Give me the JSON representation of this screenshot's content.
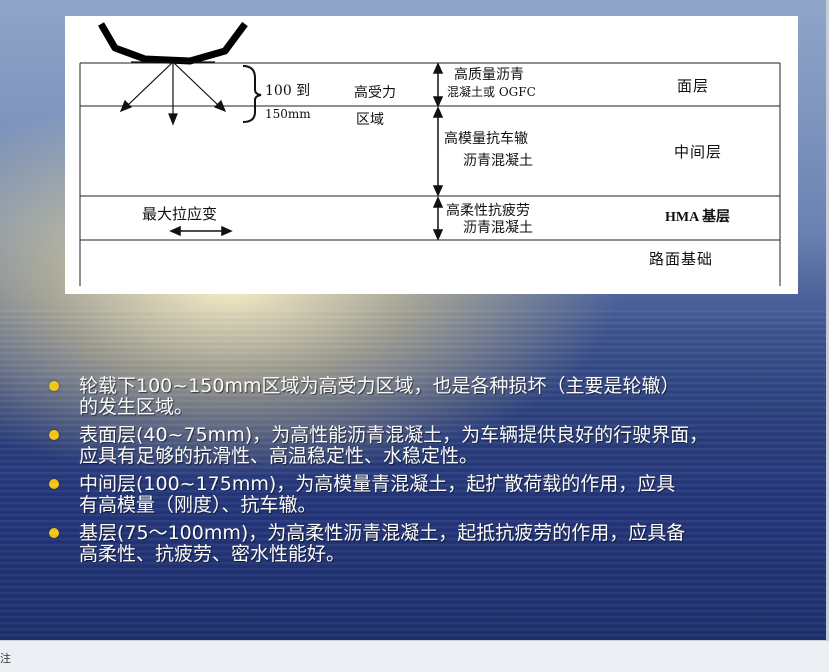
{
  "diagram": {
    "brace_line1": "100 到",
    "brace_line2": "150mm",
    "zone_line1": "高受力",
    "zone_line2": "区域",
    "surface_mat_line1": "高质量沥青",
    "surface_mat_line2": "混凝土或 OGFC",
    "surface_layer": "面层",
    "middle_mat_line1": "高模量抗车辙",
    "middle_mat_line2": "沥青混凝土",
    "middle_layer": "中间层",
    "strain_label": "最大拉应变",
    "base_mat_line1": "高柔性抗疲劳",
    "base_mat_line2": "沥青混凝土",
    "base_layer": "HMA 基层",
    "foundation_layer": "路面基础"
  },
  "bullets": [
    {
      "line1": "轮载下100~150mm区域为高受力区域，也是各种损坏（主要是轮辙）",
      "line2": "的发生区域。"
    },
    {
      "line1": "表面层(40~75mm)，为高性能沥青混凝土，为车辆提供良好的行驶界面，",
      "line2": "应具有足够的抗滑性、高温稳定性、水稳定性。"
    },
    {
      "line1": "中间层(100~175mm)，为高模量青混凝土，起扩散荷载的作用，应具",
      "line2": "有高模量（刚度）、抗车辙。"
    },
    {
      "line1": "基层(75～100mm)，为高柔性沥青混凝土，起抵抗疲劳的作用，应具备",
      "line2": "高柔性、抗疲劳、密水性能好。"
    }
  ],
  "colors": {
    "bullet": "#f6c80f",
    "text": "#ffffff"
  },
  "notes": {
    "label": "注"
  }
}
